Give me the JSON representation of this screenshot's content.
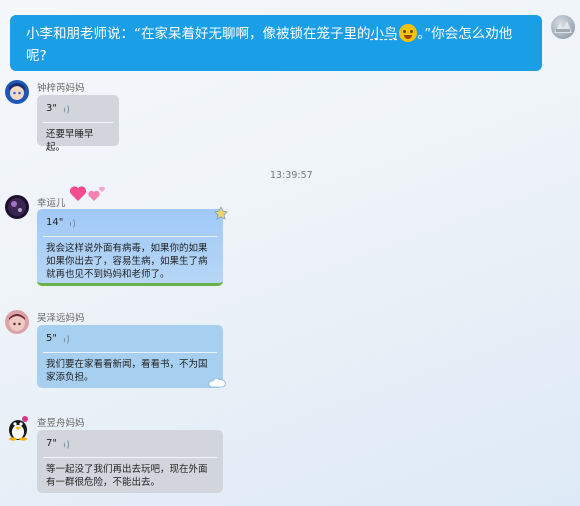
{
  "teacher_message": {
    "text_before": "小李和朋老师说：“在家呆着好无聊啊，像被锁在笼子里的",
    "underlined": "小鸟",
    "text_after": "。”你会怎么劝他呢?"
  },
  "messages": [
    {
      "name": "钟梓芮妈妈",
      "duration": "3\"",
      "text": "还要早睡早起。"
    },
    {
      "name": "幸运儿",
      "duration": "14\"",
      "text": "我会这样说外面有病毒，如果你的如果如果你出去了，容易生病，如果生了病就再也见不到妈妈和老师了。"
    },
    {
      "name": "吴泽远妈妈",
      "duration": "5\"",
      "text": "我们要在家看看新闻，看看书，不为国家添负担。"
    },
    {
      "name": "查昱舟妈妈",
      "duration": "7\"",
      "text": "等一起没了我们再出去玩吧，现在外面有一群很危险，不能出去。"
    }
  ],
  "timestamp": "13:39:57",
  "colors": {
    "teacher_bubble": "#1a9ee5",
    "gray_bubble": "#d2d6dc",
    "blue_bubble": "#a7cff0"
  }
}
